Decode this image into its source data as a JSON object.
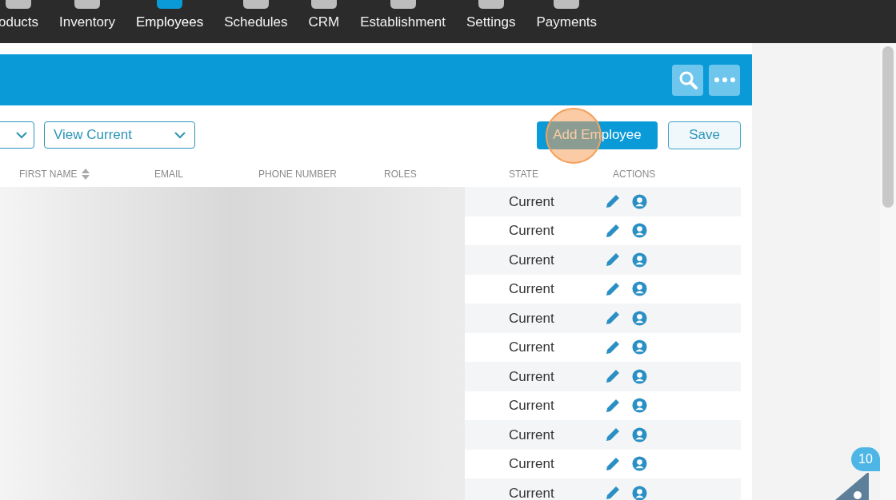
{
  "nav": [
    {
      "label": "oducts",
      "selected": false
    },
    {
      "label": "Inventory",
      "selected": false
    },
    {
      "label": "Employees",
      "selected": true
    },
    {
      "label": "Schedules",
      "selected": false
    },
    {
      "label": "CRM",
      "selected": false
    },
    {
      "label": "Establishment",
      "selected": false
    },
    {
      "label": "Settings",
      "selected": false
    },
    {
      "label": "Payments",
      "selected": false
    }
  ],
  "filters": [
    {
      "kind": "compact"
    },
    {
      "kind": "labeled",
      "value": "View Current"
    }
  ],
  "buttons": [
    {
      "label": "Add Employee",
      "kind": "primary"
    },
    {
      "label": "Save",
      "kind": "secondary"
    }
  ],
  "table": {
    "columns": [
      {
        "label": "FIRST NAME",
        "sortable": true
      },
      {
        "label": "EMAIL",
        "sortable": false
      },
      {
        "label": "PHONE NUMBER",
        "sortable": false
      },
      {
        "label": "ROLES",
        "sortable": false
      },
      {
        "label": "STATE",
        "sortable": false
      },
      {
        "label": "ACTIONS",
        "sortable": false
      }
    ],
    "rows": [
      {
        "state": "Current"
      },
      {
        "state": "Current"
      },
      {
        "state": "Current"
      },
      {
        "state": "Current"
      },
      {
        "state": "Current"
      },
      {
        "state": "Current"
      },
      {
        "state": "Current"
      },
      {
        "state": "Current"
      },
      {
        "state": "Current"
      },
      {
        "state": "Current"
      },
      {
        "state": "Current"
      }
    ]
  },
  "badge": "10"
}
